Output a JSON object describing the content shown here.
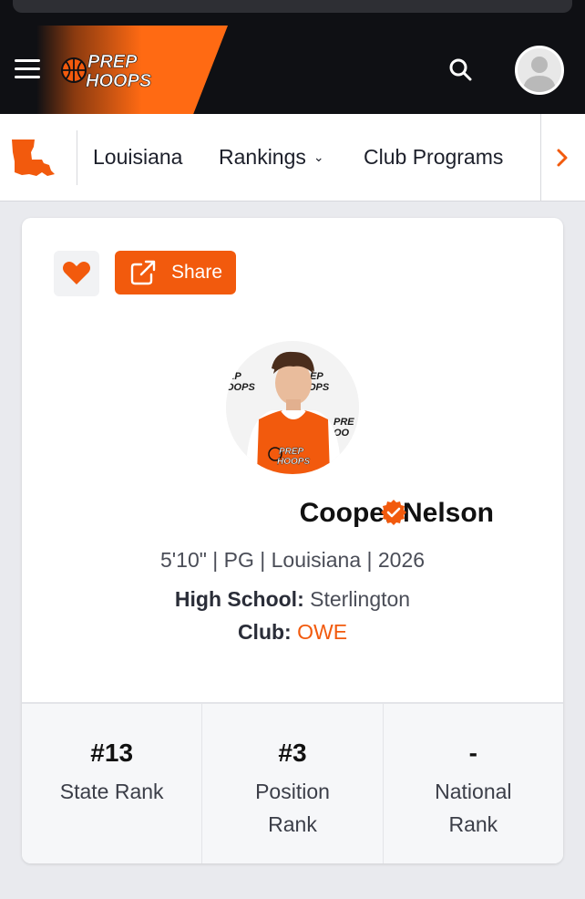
{
  "header": {
    "logo_line1": "PREP",
    "logo_line2": "HOOPS",
    "brand_color": "#f25a0d"
  },
  "subnav": {
    "state": "Louisiana",
    "rankings": "Rankings",
    "club_programs": "Club Programs"
  },
  "actions": {
    "share_label": "Share"
  },
  "player": {
    "name": "Cooper Nelson",
    "meta": "5'10\" | PG | Louisiana | 2026",
    "high_school_label": "High School:",
    "high_school": "Sterlington",
    "club_label": "Club:",
    "club": "OWE",
    "jersey_logo_line1": "PREP",
    "jersey_logo_line2": "HOOPS"
  },
  "ranks": [
    {
      "value": "#13",
      "label": "State Rank"
    },
    {
      "value": "#3",
      "label": "Position Rank"
    },
    {
      "value": "-",
      "label": "National Rank"
    }
  ]
}
